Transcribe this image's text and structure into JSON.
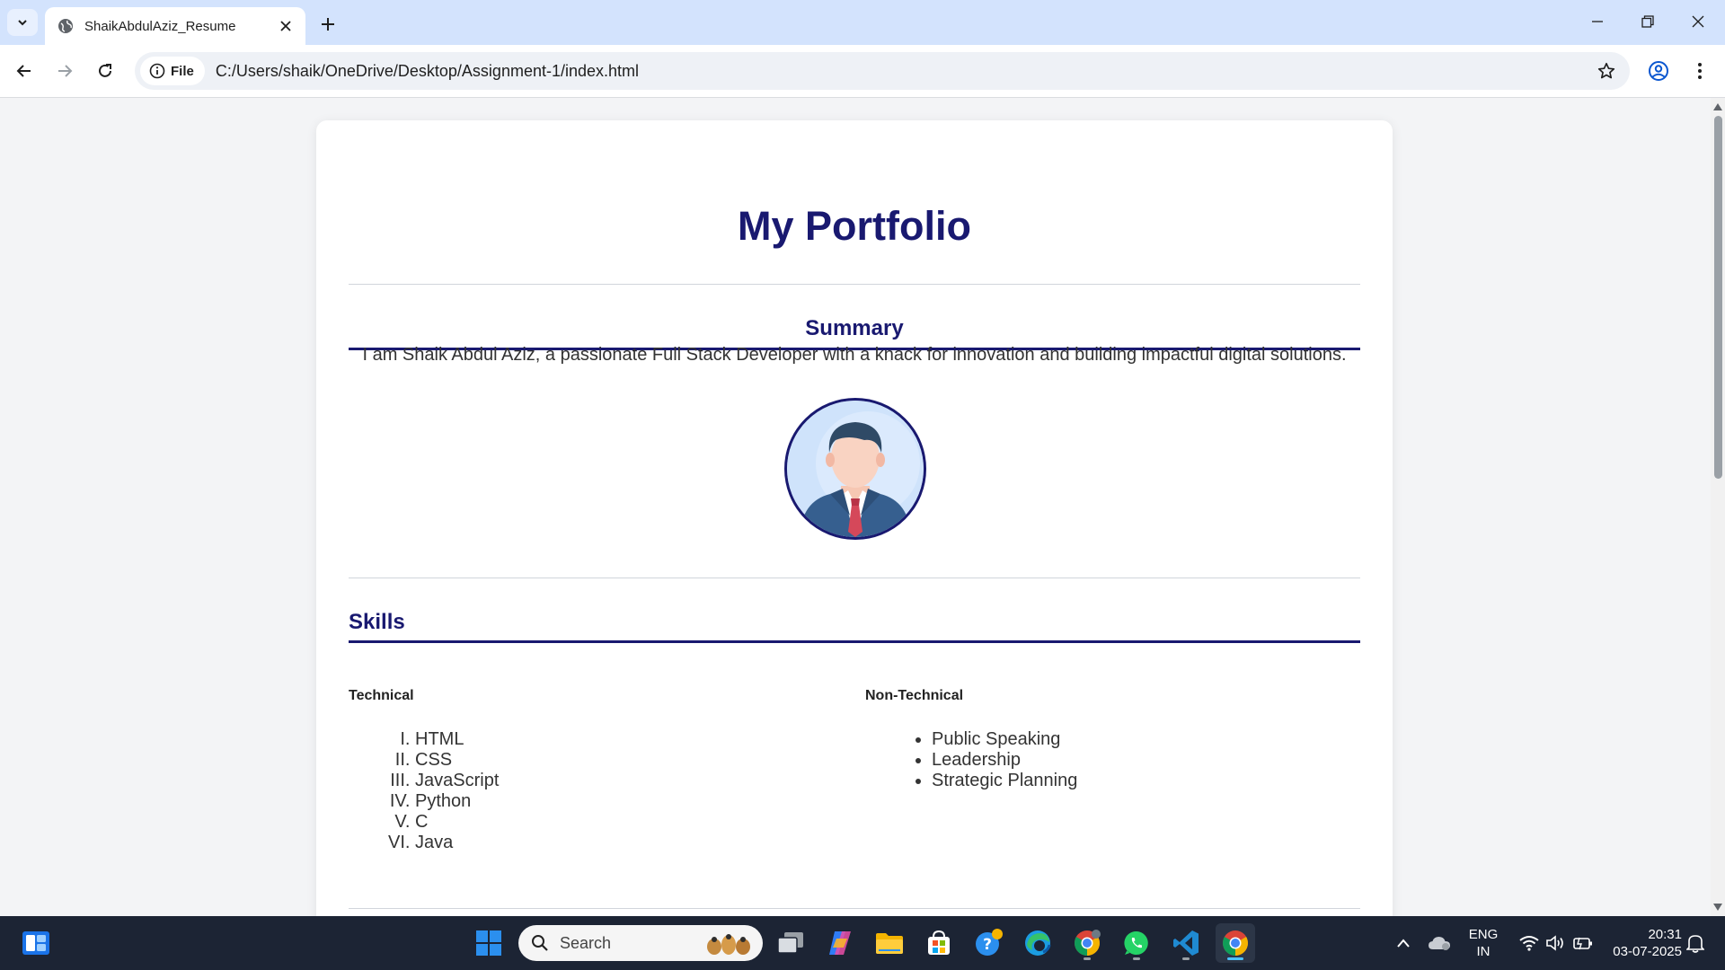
{
  "browser": {
    "tab_title": "ShaikAbdulAziz_Resume",
    "chip_label": "File",
    "url": "C:/Users/shaik/OneDrive/Desktop/Assignment-1/index.html"
  },
  "page": {
    "title": "My Portfolio",
    "summary": {
      "heading": "Summary",
      "text": "I am Shaik Abdul Aziz, a passionate Full Stack Developer with a knack for innovation and building impactful digital solutions."
    },
    "skills": {
      "heading": "Skills",
      "technical": {
        "heading": "Technical",
        "items": [
          "HTML",
          "CSS",
          "JavaScript",
          "Python",
          "C",
          "Java"
        ]
      },
      "non_technical": {
        "heading": "Non-Technical",
        "items": [
          "Public Speaking",
          "Leadership",
          "Strategic Planning"
        ]
      }
    }
  },
  "taskbar": {
    "search_placeholder": "Search",
    "language": "ENG",
    "region": "IN",
    "time": "20:31",
    "date": "03-07-2025"
  },
  "colors": {
    "heading": "#191970",
    "tabbar": "#d3e3fd",
    "taskbar": "#1c2434"
  }
}
